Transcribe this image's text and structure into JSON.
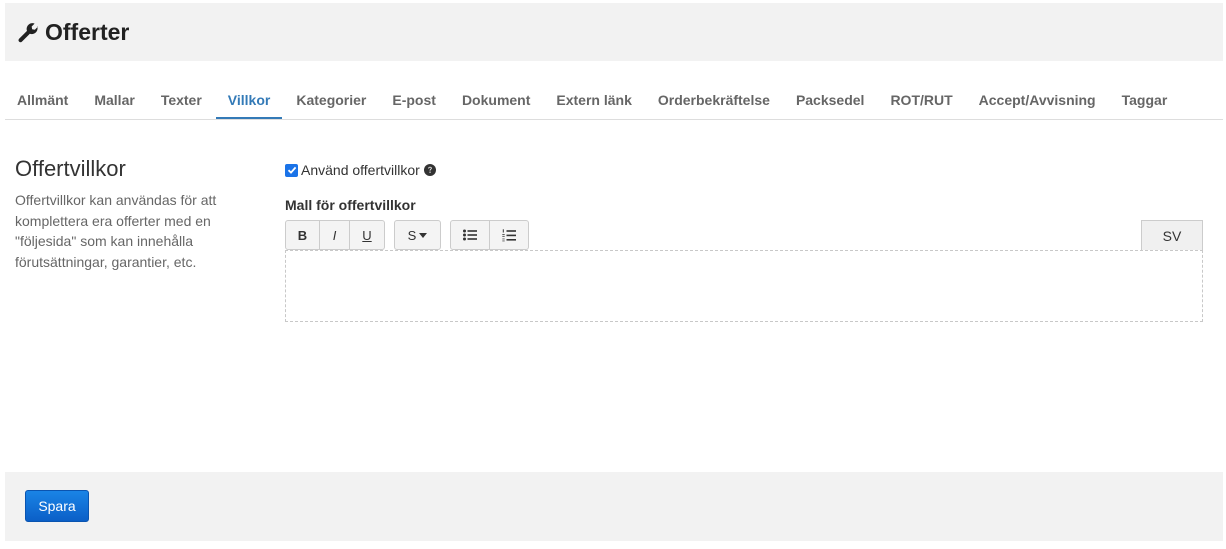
{
  "header": {
    "title": "Offerter",
    "icon": "wrench-icon"
  },
  "tabs": [
    {
      "label": "Allmänt",
      "active": false
    },
    {
      "label": "Mallar",
      "active": false
    },
    {
      "label": "Texter",
      "active": false
    },
    {
      "label": "Villkor",
      "active": true
    },
    {
      "label": "Kategorier",
      "active": false
    },
    {
      "label": "E-post",
      "active": false
    },
    {
      "label": "Dokument",
      "active": false
    },
    {
      "label": "Extern länk",
      "active": false
    },
    {
      "label": "Orderbekräftelse",
      "active": false
    },
    {
      "label": "Packsedel",
      "active": false
    },
    {
      "label": "ROT/RUT",
      "active": false
    },
    {
      "label": "Accept/Avvisning",
      "active": false
    },
    {
      "label": "Taggar",
      "active": false
    }
  ],
  "section": {
    "title": "Offertvillkor",
    "description": "Offertvillkor kan användas för att komplettera era offerter med en \"följesida\" som kan innehålla förutsättningar, garantier, etc."
  },
  "checkbox": {
    "label": "Använd offertvillkor",
    "checked": true
  },
  "editor": {
    "label": "Mall för offertvillkor",
    "bold": "B",
    "italic": "I",
    "underline": "U",
    "style": "S",
    "language": "SV",
    "content": ""
  },
  "footer": {
    "save_label": "Spara"
  },
  "colors": {
    "accent": "#337ab7",
    "primary_button": "#0b5fc7",
    "checkbox": "#1a73e8"
  }
}
